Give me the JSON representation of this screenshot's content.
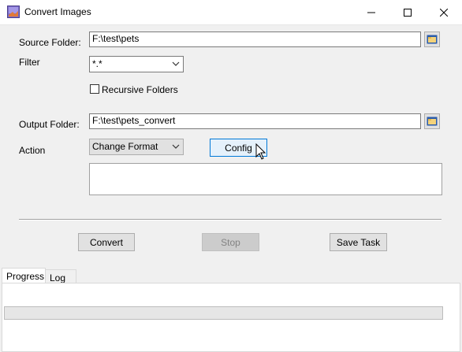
{
  "window": {
    "title": "Convert Images"
  },
  "source": {
    "label": "Source Folder:",
    "value": "F:\\test\\pets"
  },
  "filter": {
    "label": "Filter",
    "value": "*.*"
  },
  "recursive": {
    "label": "Recursive Folders",
    "checked": false
  },
  "output": {
    "label": "Output Folder:",
    "value": "F:\\test\\pets_convert"
  },
  "action": {
    "label": "Action",
    "value": "Change Format",
    "config_label": "Config"
  },
  "buttons": {
    "convert": "Convert",
    "stop": "Stop",
    "save_task": "Save Task"
  },
  "tabs": [
    {
      "label": "Progress"
    },
    {
      "label": "Log"
    }
  ],
  "progress": {
    "value": 0
  }
}
